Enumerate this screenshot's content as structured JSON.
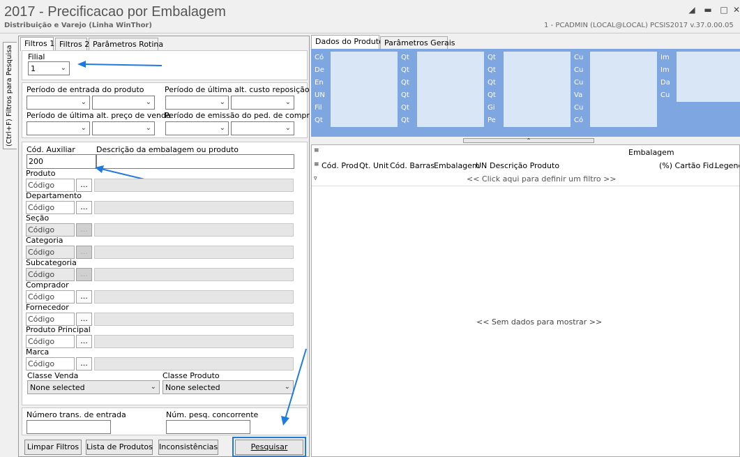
{
  "window": {
    "title": "2017 - Precificacao por Embalagem",
    "subtitle": "Distribuição e Varejo (Linha WinThor)",
    "user_info": "1 - PCADMIN (LOCAL@LOCAL)   PCSIS2017  v.37.0.00.05"
  },
  "side_tab": {
    "label": "(Ctrl+F) Filtros para Pesquisa"
  },
  "left_tabs": [
    "Filtros 1",
    "Filtros 2",
    "Parâmetros Rotina"
  ],
  "filters": {
    "filial_label": "Filial",
    "filial_value": "1",
    "periodo_entrada": "Período de entrada do produto",
    "periodo_custo": "Período de última alt. custo reposição",
    "periodo_preco": "Período de última alt. preço de venda",
    "periodo_emissao": "Período de emissão do ped. de compra",
    "cod_auxiliar_label": "Cód. Auxiliar",
    "cod_auxiliar_value": "200",
    "descricao_label": "Descrição da embalagem ou produto",
    "codigo_placeholder": "Código",
    "dots": "...",
    "rows": [
      {
        "label": "Produto",
        "disabled": false
      },
      {
        "label": "Departamento",
        "disabled": false
      },
      {
        "label": "Seção",
        "disabled": true
      },
      {
        "label": "Categoria",
        "disabled": true
      },
      {
        "label": "Subcategoria",
        "disabled": true
      },
      {
        "label": "Comprador",
        "disabled": false
      },
      {
        "label": "Fornecedor",
        "disabled": false
      },
      {
        "label": "Produto Principal",
        "disabled": false
      },
      {
        "label": "Marca",
        "disabled": false
      }
    ],
    "classe_venda_label": "Classe Venda",
    "classe_venda_value": "None selected",
    "classe_produto_label": "Classe Produto",
    "classe_produto_value": "None selected",
    "num_trans_label": "Número trans. de entrada",
    "num_pesq_label": "Núm. pesq. concorrente"
  },
  "buttons": {
    "limpar": "Limpar Filtros",
    "lista": "Lista de Produtos",
    "inconsistencias": "Inconsistências",
    "pesquisar": "Pesquisar"
  },
  "right_tabs": [
    "Dados do Produto",
    "Parâmetros Gerais"
  ],
  "product_columns": [
    [
      "Có",
      "De",
      "En",
      "UN",
      "Fil",
      "Qt"
    ],
    [
      "Qt",
      "Qt",
      "Qt",
      "Qt",
      "Qt",
      "Qt"
    ],
    [
      "Qt",
      "Qt",
      "Qt",
      "Qt",
      "Gi",
      "Pe"
    ],
    [
      "Cu",
      "Cu",
      "Cu",
      "Va",
      "Cu",
      "Có"
    ],
    [
      "Im",
      "Im",
      "Da",
      "Cu"
    ]
  ],
  "grid": {
    "band_header": "Embalagem",
    "columns": [
      "Cód. Prod",
      "Qt. Unit",
      "Cód. Barras",
      "Embalagem",
      "UN",
      "Descrição Produto",
      "(%) Cartão Fid.",
      "Legenda"
    ],
    "filter_hint": "<< Click aqui para definir um filtro >>",
    "empty_text": "<< Sem dados para mostrar >>"
  },
  "colors": {
    "accent": "#1e7ae0",
    "header_blue": "#7ea6e0",
    "cell_blue": "#d8e6f6"
  }
}
